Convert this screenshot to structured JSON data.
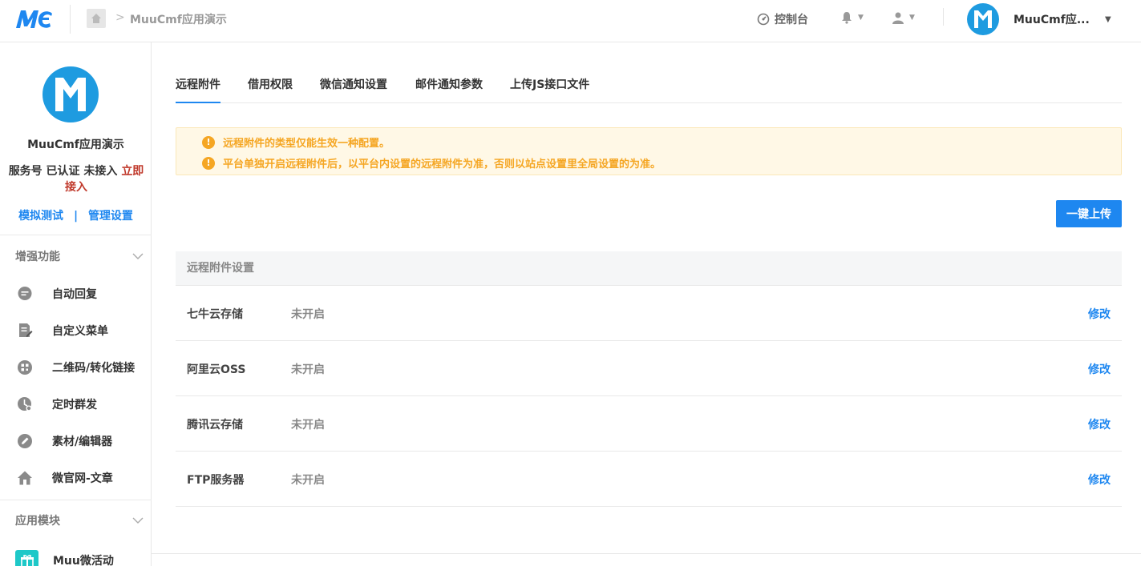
{
  "topbar": {
    "breadcrumb_title": "MuuCmf应用演示",
    "console_label": "控制台",
    "account_name": "MuuCmf应..."
  },
  "sidebar": {
    "account_name": "MuuCmf应用演示",
    "status_prefix": "服务号 已认证 未接入",
    "status_link": "立即接入",
    "link_test": "模拟测试",
    "link_sep": "|",
    "link_manage": "管理设置",
    "group_enhance": "增强功能",
    "enhance_items": [
      {
        "label": "自动回复",
        "icon": "chat-bubble-icon"
      },
      {
        "label": "自定义菜单",
        "icon": "edit-document-icon"
      },
      {
        "label": "二维码/转化链接",
        "icon": "qrcode-icon"
      },
      {
        "label": "定时群发",
        "icon": "clock-icon"
      },
      {
        "label": "素材/编辑器",
        "icon": "pencil-icon"
      },
      {
        "label": "微官网-文章",
        "icon": "home-icon"
      }
    ],
    "group_apps": "应用模块",
    "app_items": [
      {
        "label": "Muu微活动",
        "icon": "gift-icon"
      }
    ]
  },
  "tabs": [
    "远程附件",
    "借用权限",
    "微信通知设置",
    "邮件通知参数",
    "上传JS接口文件"
  ],
  "notice": [
    "远程附件的类型仅能生效一种配置。",
    "平台单独开启远程附件后，以平台内设置的远程附件为准，否则以站点设置里全局设置的为准。"
  ],
  "upload_button": "一键上传",
  "table": {
    "header": "远程附件设置",
    "rows": [
      {
        "name": "七牛云存储",
        "status": "未开启",
        "action": "修改"
      },
      {
        "name": "阿里云OSS",
        "status": "未开启",
        "action": "修改"
      },
      {
        "name": "腾讯云存储",
        "status": "未开启",
        "action": "修改"
      },
      {
        "name": "FTP服务器",
        "status": "未开启",
        "action": "修改"
      }
    ]
  },
  "colors": {
    "accent": "#1e87f0",
    "warning": "#f5a623",
    "danger": "#c0392b"
  }
}
